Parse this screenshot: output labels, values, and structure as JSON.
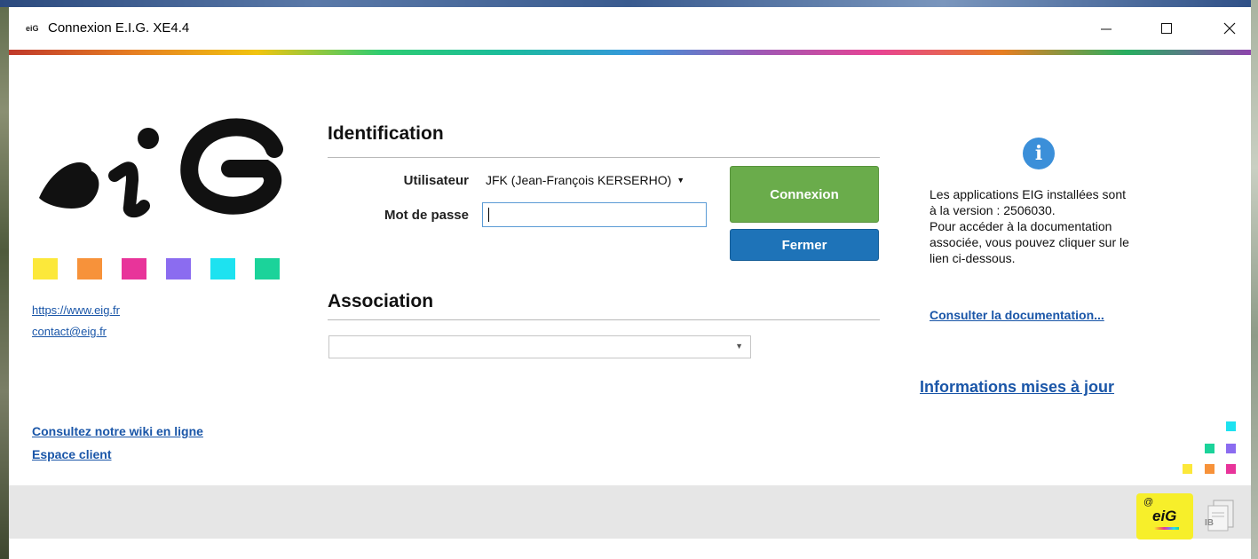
{
  "window": {
    "title": "Connexion E.I.G. XE4.4",
    "icon": "eig-app-icon",
    "controls": {
      "minimize": "—",
      "maximize": "☐",
      "close": "✕"
    }
  },
  "logo": {
    "text": "eiG",
    "palette": [
      "#fce83a",
      "#f7923a",
      "#e8349a",
      "#8b6cf0",
      "#1de2f0",
      "#1bd39a"
    ]
  },
  "links": {
    "website": "https://www.eig.fr",
    "contact": "contact@eig.fr",
    "wiki": "Consultez notre wiki en ligne",
    "client_space": "Espace client"
  },
  "identification": {
    "title": "Identification",
    "user_label": "Utilisateur",
    "user_value": "JFK (Jean-François KERSERHO)",
    "password_label": "Mot de passe",
    "password_value": ""
  },
  "buttons": {
    "connect": "Connexion",
    "close": "Fermer"
  },
  "association": {
    "title": "Association",
    "value": ""
  },
  "info": {
    "lines": [
      "Les applications EIG installées sont",
      "à la version : 2506030.",
      "Pour accéder à la documentation",
      "associée, vous pouvez cliquer sur le",
      "lien ci-dessous."
    ],
    "doc_link": "Consulter la documentation...",
    "updates_link": "Informations mises à jour"
  },
  "footer": {
    "badge_text": "eiG",
    "ib_text": "IB"
  }
}
